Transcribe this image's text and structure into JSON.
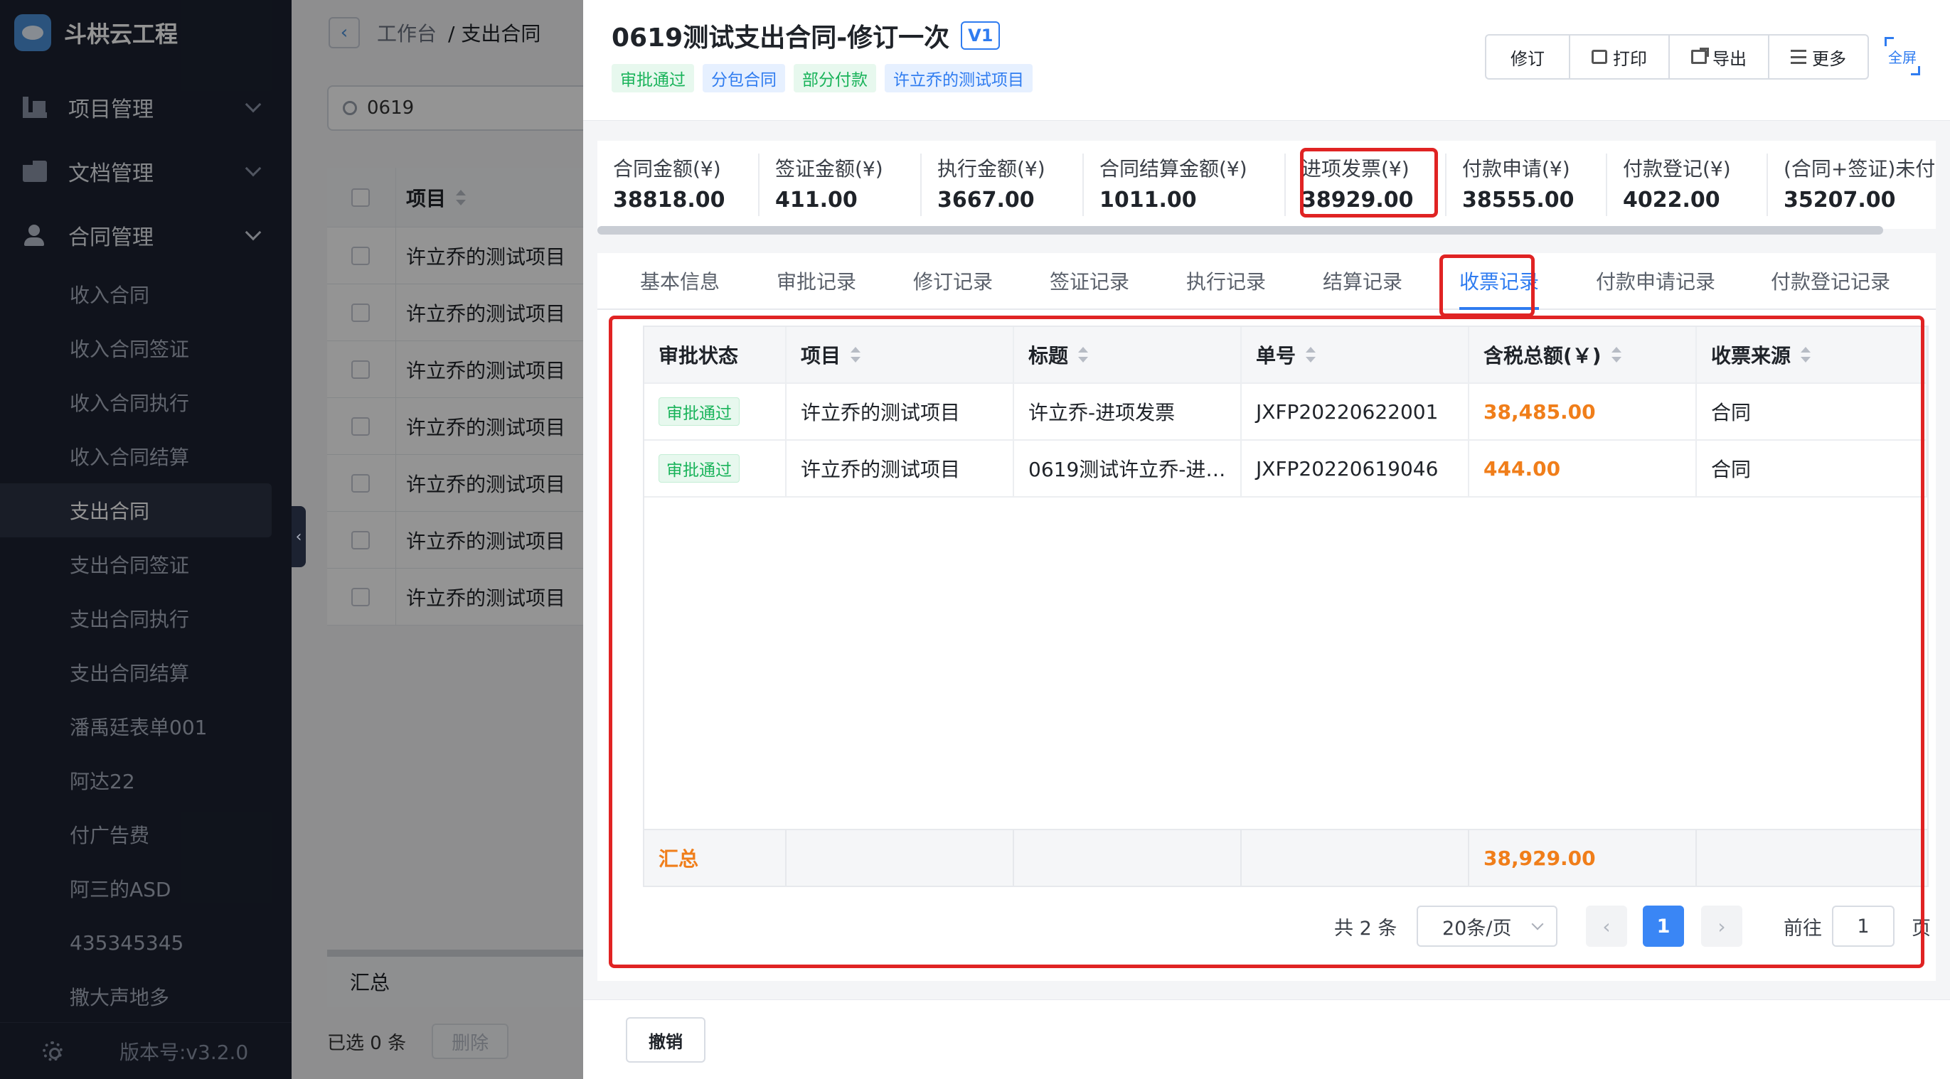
{
  "sidebar": {
    "brand": "斗栱云工程",
    "groups": [
      {
        "label": "项目管理",
        "icon": "building-icon"
      },
      {
        "label": "文档管理",
        "icon": "folder-icon"
      },
      {
        "label": "合同管理",
        "icon": "user-icon"
      }
    ],
    "items": [
      "收入合同",
      "收入合同签证",
      "收入合同执行",
      "收入合同结算",
      "支出合同",
      "支出合同签证",
      "支出合同执行",
      "支出合同结算",
      "潘禹廷表单001",
      "阿达22",
      "付广告费",
      "阿三的ASD",
      "435345345",
      "撒大声地多"
    ],
    "active_item": "支出合同",
    "version": "版本号:v3.2.0"
  },
  "background": {
    "breadcrumb_home": "工作台",
    "breadcrumb_current": "/ 支出合同",
    "search_value": "0619",
    "column_project": "项目",
    "rows": [
      "许立乔的测试项目",
      "许立乔的测试项目",
      "许立乔的测试项目",
      "许立乔的测试项目",
      "许立乔的测试项目",
      "许立乔的测试项目",
      "许立乔的测试项目"
    ],
    "sum_label": "汇总",
    "selected": "已选 0 条",
    "delete_label": "删除"
  },
  "drawer": {
    "title": "0619测试支出合同-修订一次",
    "version_badge": "V1",
    "tags": [
      {
        "text": "审批通过",
        "style": "green"
      },
      {
        "text": "分包合同",
        "style": "blue"
      },
      {
        "text": "部分付款",
        "style": "green"
      },
      {
        "text": "许立乔的测试项目",
        "style": "blue"
      }
    ],
    "actions": {
      "revise": "修订",
      "print": "打印",
      "export": "导出",
      "more": "更多",
      "fullscreen": "全屏"
    },
    "stats": [
      {
        "label": "合同金额(¥)",
        "value": "38818.00"
      },
      {
        "label": "签证金额(¥)",
        "value": "411.00"
      },
      {
        "label": "执行金额(¥)",
        "value": "3667.00"
      },
      {
        "label": "合同结算金额(¥)",
        "value": "1011.00"
      },
      {
        "label": "进项发票(¥)",
        "value": "38929.00"
      },
      {
        "label": "付款申请(¥)",
        "value": "38555.00"
      },
      {
        "label": "付款登记(¥)",
        "value": "4022.00"
      },
      {
        "label": "(合同+签证)未付",
        "value": "35207.00"
      }
    ],
    "tabs": [
      "基本信息",
      "审批记录",
      "修订记录",
      "签证记录",
      "执行记录",
      "结算记录",
      "收票记录",
      "付款申请记录",
      "付款登记记录"
    ],
    "active_tab": "收票记录",
    "table": {
      "columns": [
        "审批状态",
        "项目",
        "标题",
        "单号",
        "含税总额(￥)",
        "收票来源"
      ],
      "rows": [
        {
          "status": "审批通过",
          "project": "许立乔的测试项目",
          "title": "许立乔-进项发票",
          "number": "JXFP20220622001",
          "amount": "38,485.00",
          "source": "合同"
        },
        {
          "status": "审批通过",
          "project": "许立乔的测试项目",
          "title": "0619测试许立乔-进…",
          "number": "JXFP20220619046",
          "amount": "444.00",
          "source": "合同"
        }
      ],
      "sum_label": "汇总",
      "sum_amount": "38,929.00"
    },
    "pager": {
      "total": "共 2 条",
      "page_size": "20条/页",
      "current": "1",
      "goto_label": "前往",
      "goto_value": "1",
      "unit": "页",
      "prev": "‹",
      "next": "›"
    },
    "cancel_label": "撤销"
  },
  "colors": {
    "accent": "#2f7cf0",
    "amount": "#f07e1a",
    "success": "#19b35a",
    "highlight": "#e02323",
    "sidebar": "#1c2231"
  }
}
